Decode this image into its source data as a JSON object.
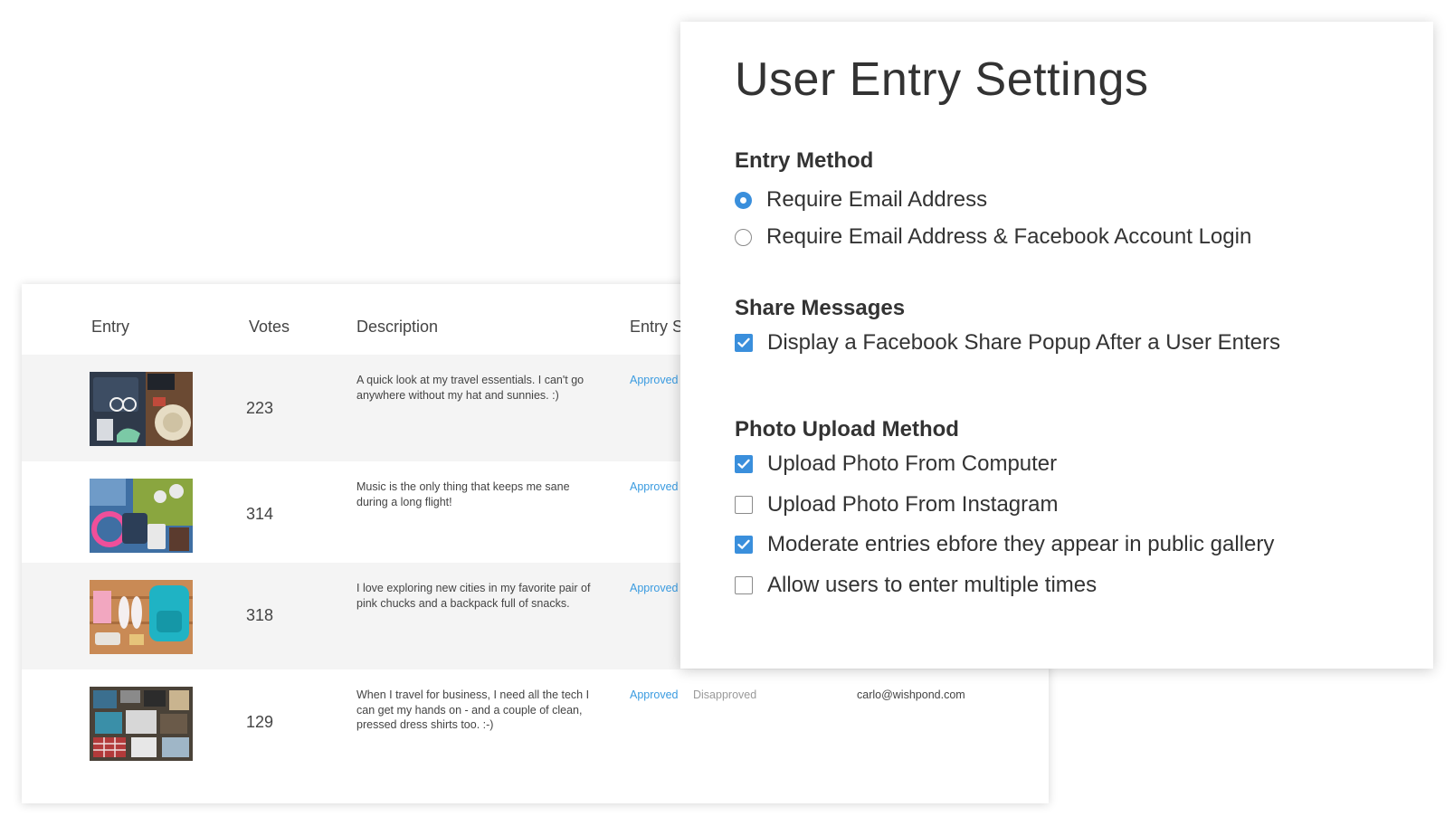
{
  "table": {
    "headers": {
      "entry": "Entry",
      "votes": "Votes",
      "description": "Description",
      "status": "Entry S"
    },
    "rows": [
      {
        "image_icon": "travel-essentials-photo",
        "votes": "223",
        "description": "A quick look at my travel essentials. I can't go anywhere without my hat and sunnies. :)",
        "approved": "Approved"
      },
      {
        "image_icon": "headphones-travel-photo",
        "votes": "314",
        "description": "Music is the only thing that keeps me sane during a long flight!",
        "approved": "Approved"
      },
      {
        "image_icon": "backpack-sneakers-photo",
        "votes": "318",
        "description": "I love exploring new cities in my favorite pair of pink chucks and a backpack full of snacks.",
        "approved": "Approved"
      },
      {
        "image_icon": "business-travel-photo",
        "votes": "129",
        "description": "When I travel for business, I need all the tech I can get my hands on - and a couple of clean, pressed dress shirts too. :-)",
        "approved": "Approved",
        "disapproved": "Disapproved",
        "email": "carlo@wishpond.com"
      }
    ]
  },
  "settings": {
    "title": "User Entry Settings",
    "entry_method": {
      "heading": "Entry Method",
      "options": [
        {
          "label": "Require Email Address",
          "selected": true
        },
        {
          "label": "Require Email Address & Facebook Account Login",
          "selected": false
        }
      ]
    },
    "share_messages": {
      "heading": "Share Messages",
      "options": [
        {
          "label": "Display a Facebook Share Popup After a User Enters",
          "checked": true
        }
      ]
    },
    "photo_upload": {
      "heading": "Photo Upload Method",
      "options": [
        {
          "label": "Upload Photo From Computer",
          "checked": true
        },
        {
          "label": "Upload Photo From Instagram",
          "checked": false
        },
        {
          "label": "Moderate entries ebfore they appear in public gallery",
          "checked": true
        },
        {
          "label": "Allow users to enter multiple times",
          "checked": false
        }
      ]
    }
  },
  "colors": {
    "accent": "#3a8fdc",
    "approved": "#3a9be0",
    "disapproved": "#9a9a9a",
    "row_shade": "#f4f4f4"
  }
}
